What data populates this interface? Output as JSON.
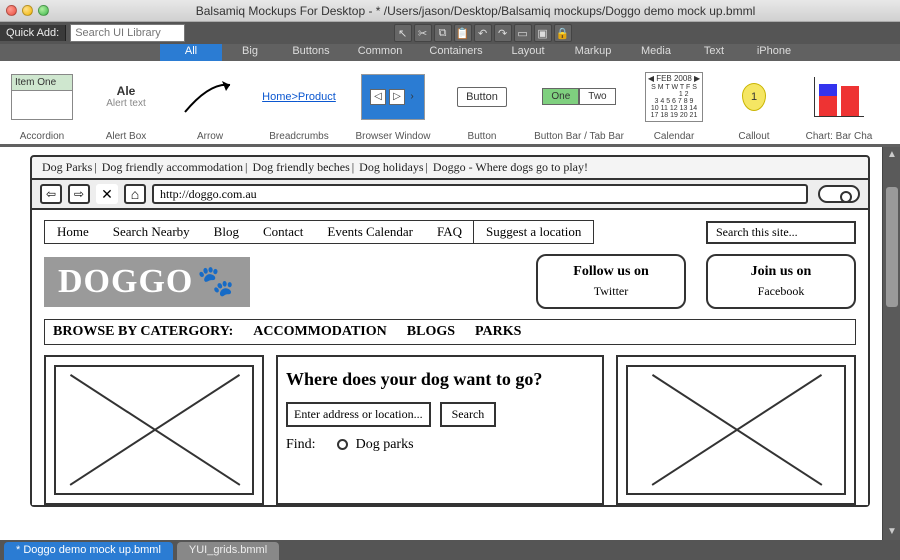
{
  "window": {
    "title": "Balsamiq Mockups For Desktop - * /Users/jason/Desktop/Balsamiq mockups/Doggo demo mock up.bmml"
  },
  "quickadd": {
    "label": "Quick Add:",
    "placeholder": "Search UI Library"
  },
  "categories": [
    "All",
    "Big",
    "Buttons",
    "Common",
    "Containers",
    "Layout",
    "Markup",
    "Media",
    "Text",
    "iPhone"
  ],
  "active_category": "All",
  "shelf": {
    "accordion": {
      "label": "Accordion",
      "item": "Item One"
    },
    "alertbox": {
      "label": "Alert Box",
      "title": "Ale",
      "sub": "Alert text"
    },
    "arrow": {
      "label": "Arrow"
    },
    "breadcrumbs": {
      "label": "Breadcrumbs",
      "p1": "Home",
      "p2": "Product"
    },
    "browser": {
      "label": "Browser Window"
    },
    "button": {
      "label": "Button",
      "text": "Button"
    },
    "buttonbar": {
      "label": "Button Bar / Tab Bar",
      "b1": "One",
      "b2": "Two"
    },
    "calendar": {
      "label": "Calendar",
      "month": "◀ FEB 2008 ▶",
      "grid": "S M T W T F S\n          1 2\n3 4 5 6 7 8 9\n10 11 12 13 14\n17 18 19 20 21"
    },
    "callout": {
      "label": "Callout",
      "num": "1"
    },
    "chart": {
      "label": "Chart: Bar Cha"
    }
  },
  "mock": {
    "linkbar": [
      "Dog Parks",
      "Dog friendly accommodation",
      "Dog friendly beches",
      "Dog holidays",
      "Doggo - Where dogs go to play!"
    ],
    "url": "http://doggo.com.au",
    "nav": [
      "Home",
      "Search Nearby",
      "Blog",
      "Contact",
      "Events Calendar",
      "FAQ",
      "Suggest a location"
    ],
    "site_search_placeholder": "Search this site...",
    "logo": "DOGGO",
    "social1": {
      "l1": "Follow us on",
      "l2": "Twitter"
    },
    "social2": {
      "l1": "Join us on",
      "l2": "Facebook"
    },
    "browse": {
      "lead": "BROWSE BY CATERGORY:",
      "c1": "ACCOMMODATION",
      "c2": "BLOGS",
      "c3": "PARKS"
    },
    "question": {
      "heading": "Where does your dog want to go?",
      "input_ph": "Enter address or location...",
      "search_btn": "Search",
      "find_label": "Find:",
      "opt1": "Dog parks"
    }
  },
  "doctabs": {
    "active": "* Doggo demo mock up.bmml",
    "inactive": "YUI_grids.bmml"
  }
}
